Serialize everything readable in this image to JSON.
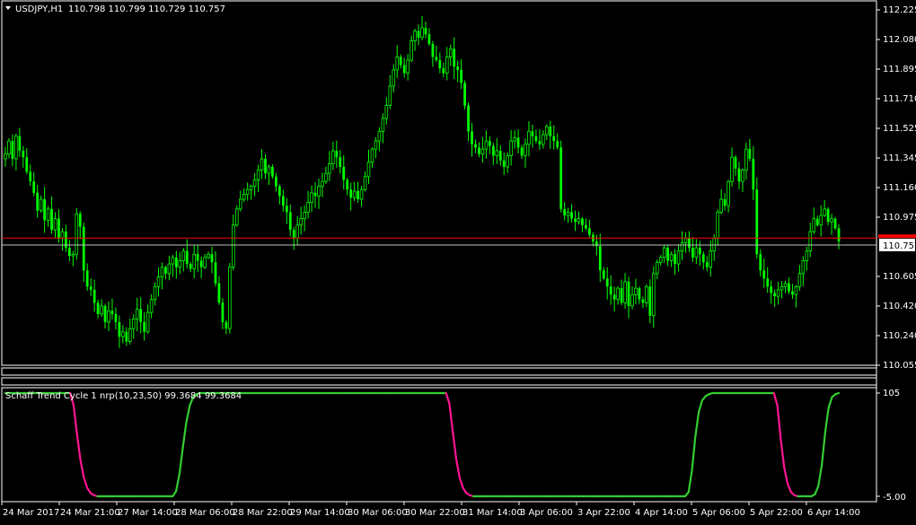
{
  "main_chart": {
    "symbol_tf": "USDJPY,H1",
    "ohlc": "110.798 110.799 110.729 110.757",
    "menu_arrow_icon": "triangle-down-icon",
    "price_axis": [
      "112.225",
      "112.080",
      "111.895",
      "111.710",
      "111.525",
      "111.345",
      "111.160",
      "110.975",
      "110.605",
      "110.420",
      "110.240",
      "110.055"
    ],
    "current_price": "110.757",
    "current_price_value": 110.757,
    "red_line_price": 110.8,
    "colors": {
      "bull": "#00ff00",
      "bear": "#00ff00",
      "wick": "#00ff00",
      "red_line": "#ff0000",
      "current_line": "#c0c0c0"
    }
  },
  "indicator": {
    "label": "Schaff Trend Cycle 1 nrp(10,23,50) 99.3684 99.3684",
    "axis_top": "105",
    "axis_bottom": "-5.00",
    "colors": {
      "up": "#32cd32",
      "down": "#ff1493"
    }
  },
  "time_axis": [
    "24 Mar 2017",
    "24 Mar 21:00",
    "27 Mar 14:00",
    "28 Mar 06:00",
    "28 Mar 22:00",
    "29 Mar 14:00",
    "30 Mar 06:00",
    "30 Mar 22:00",
    "31 Mar 14:00",
    "3 Apr 06:00",
    "3 Apr 22:00",
    "4 Apr 14:00",
    "5 Apr 06:00",
    "5 Apr 22:00",
    "6 Apr 14:00"
  ],
  "chart_data": {
    "type": "candlestick",
    "ylim": [
      110.03,
      112.25
    ],
    "closes": [
      111.32,
      111.4,
      111.29,
      111.43,
      111.34,
      111.3,
      111.21,
      111.15,
      111.08,
      110.97,
      111.04,
      110.91,
      110.98,
      110.85,
      110.92,
      110.8,
      110.84,
      110.74,
      110.69,
      110.7,
      110.95,
      110.87,
      110.6,
      110.5,
      110.48,
      110.4,
      110.33,
      110.38,
      110.28,
      110.35,
      110.33,
      110.28,
      110.19,
      110.22,
      110.16,
      110.24,
      110.3,
      110.36,
      110.28,
      110.22,
      110.34,
      110.42,
      110.5,
      110.56,
      110.62,
      110.58,
      110.64,
      110.68,
      110.62,
      110.66,
      110.72,
      110.64,
      110.61,
      110.7,
      110.66,
      110.62,
      110.68,
      110.7,
      110.65,
      110.52,
      110.4,
      110.28,
      110.24,
      110.62,
      110.88,
      110.98,
      111.04,
      111.07,
      111.1,
      111.12,
      111.16,
      111.22,
      111.29,
      111.2,
      111.24,
      111.18,
      111.12,
      111.06,
      111.0,
      110.96,
      110.85,
      110.8,
      110.88,
      110.92,
      110.96,
      111.02,
      111.08,
      111.06,
      111.12,
      111.15,
      111.2,
      111.26,
      111.34,
      111.3,
      111.24,
      111.16,
      111.1,
      111.05,
      111.09,
      111.04,
      111.1,
      111.18,
      111.27,
      111.35,
      111.4,
      111.46,
      111.54,
      111.62,
      111.74,
      111.84,
      111.92,
      111.87,
      111.82,
      111.9,
      112.02,
      112.08,
      112.04,
      112.1,
      112.06,
      112.0,
      111.92,
      111.9,
      111.85,
      111.82,
      111.92,
      111.97,
      111.86,
      111.84,
      111.76,
      111.62,
      111.46,
      111.38,
      111.36,
      111.32,
      111.35,
      111.4,
      111.37,
      111.31,
      111.34,
      111.28,
      111.24,
      111.31,
      111.4,
      111.42,
      111.36,
      111.31,
      111.38,
      111.46,
      111.43,
      111.4,
      111.38,
      111.44,
      111.49,
      111.43,
      111.4,
      111.36,
      110.98,
      110.94,
      110.96,
      110.92,
      110.9,
      110.92,
      110.88,
      110.86,
      110.82,
      110.78,
      110.75,
      110.6,
      110.55,
      110.5,
      110.45,
      110.42,
      110.49,
      110.4,
      110.53,
      110.38,
      110.45,
      110.49,
      110.42,
      110.4,
      110.5,
      110.32,
      110.58,
      110.65,
      110.68,
      110.74,
      110.66,
      110.7,
      110.64,
      110.72,
      110.77,
      110.8,
      110.74,
      110.68,
      110.74,
      110.7,
      110.65,
      110.62,
      110.72,
      110.8,
      110.96,
      111.04,
      111.0,
      111.15,
      111.3,
      111.23,
      111.15,
      111.22,
      111.35,
      111.29,
      111.1,
      110.7,
      110.6,
      110.55,
      110.5,
      110.46,
      110.44,
      110.48,
      110.5,
      110.52,
      110.47,
      110.45,
      110.5,
      110.58,
      110.66,
      110.72,
      110.84,
      110.92,
      110.88,
      110.94,
      110.98,
      110.9,
      110.92,
      110.86,
      110.78
    ],
    "stc": [
      100,
      100,
      100,
      100,
      100,
      100,
      100,
      100,
      100,
      100,
      100,
      100,
      100,
      100,
      100,
      100,
      100,
      100,
      100,
      100,
      88,
      60,
      35,
      18,
      8,
      3,
      1,
      0,
      0,
      0,
      0,
      0,
      0,
      0,
      0,
      0,
      0,
      0,
      0,
      0,
      0,
      0,
      0,
      0,
      0,
      0,
      0,
      0,
      0,
      0,
      5,
      22,
      48,
      72,
      88,
      96,
      99,
      100,
      100,
      100,
      100,
      100,
      100,
      100,
      100,
      100,
      100,
      100,
      100,
      100,
      100,
      100,
      100,
      100,
      100,
      100,
      100,
      100,
      100,
      100,
      100,
      100,
      100,
      100,
      100,
      100,
      100,
      100,
      100,
      100,
      100,
      100,
      100,
      100,
      100,
      100,
      100,
      100,
      100,
      100,
      100,
      100,
      100,
      100,
      100,
      100,
      100,
      100,
      100,
      100,
      100,
      100,
      100,
      100,
      100,
      100,
      100,
      100,
      100,
      100,
      100,
      100,
      100,
      100,
      100,
      100,
      100,
      100,
      100,
      100,
      90,
      62,
      36,
      18,
      8,
      3,
      1,
      0,
      0,
      0,
      0,
      0,
      0,
      0,
      0,
      0,
      0,
      0,
      0,
      0,
      0,
      0,
      0,
      0,
      0,
      0,
      0,
      0,
      0,
      0,
      0,
      0,
      0,
      0,
      0,
      0,
      0,
      0,
      0,
      0,
      0,
      0,
      0,
      0,
      0,
      0,
      0,
      0,
      0,
      0,
      0,
      0,
      0,
      0,
      0,
      0,
      0,
      0,
      0,
      0,
      0,
      0,
      0,
      0,
      0,
      0,
      0,
      0,
      0,
      0,
      4,
      25,
      58,
      82,
      93,
      97,
      99,
      100,
      100,
      100,
      100,
      100,
      100,
      100,
      100,
      100,
      100,
      100,
      100,
      100,
      100,
      100,
      100,
      100,
      100,
      100,
      88,
      55,
      28,
      12,
      4,
      1,
      0,
      0,
      0,
      0,
      0,
      2,
      10,
      30,
      62,
      86,
      96,
      99,
      100
    ],
    "stc_range": [
      -5,
      105
    ]
  }
}
